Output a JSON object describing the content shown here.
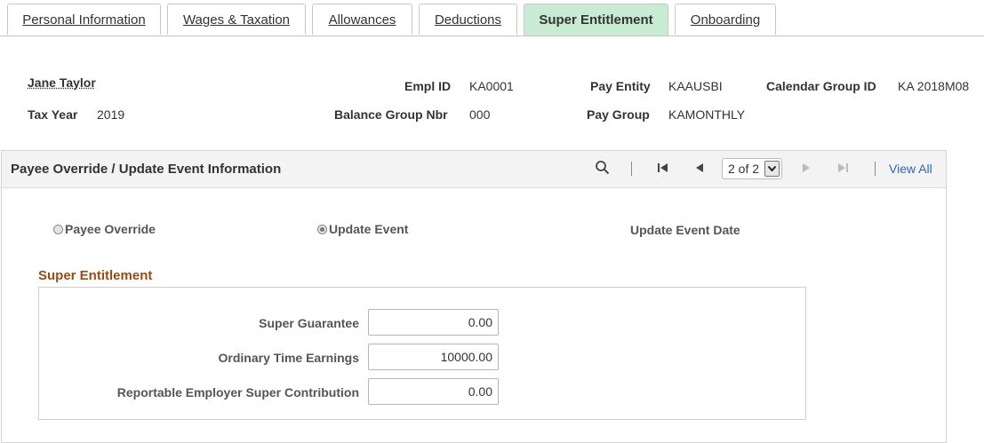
{
  "tabs": [
    {
      "label": "Personal Information",
      "active": false
    },
    {
      "label": "Wages & Taxation",
      "active": false
    },
    {
      "label": "Allowances",
      "active": false
    },
    {
      "label": "Deductions",
      "active": false
    },
    {
      "label": "Super Entitlement",
      "active": true
    },
    {
      "label": "Onboarding",
      "active": false
    }
  ],
  "header": {
    "employee_name": "Jane Taylor",
    "empl_id_label": "Empl ID",
    "empl_id_value": "KA0001",
    "pay_entity_label": "Pay Entity",
    "pay_entity_value": "KAAUSBI",
    "calendar_group_label": "Calendar Group ID",
    "calendar_group_value": "KA 2018M08",
    "tax_year_label": "Tax Year",
    "tax_year_value": "2019",
    "balance_group_label": "Balance Group Nbr",
    "balance_group_value": "000",
    "pay_group_label": "Pay Group",
    "pay_group_value": "KAMONTHLY"
  },
  "group": {
    "title": "Payee Override / Update Event Information",
    "pager_value": "2 of 2",
    "view_all": "View All"
  },
  "options": {
    "payee_override": "Payee Override",
    "update_event": "Update Event",
    "update_event_date": "Update Event Date",
    "selected": "update_event"
  },
  "super_entitlement": {
    "title": "Super Entitlement",
    "fields": [
      {
        "label": "Super Guarantee",
        "value": "0.00"
      },
      {
        "label": "Ordinary Time Earnings",
        "value": "10000.00"
      },
      {
        "label": "Reportable Employer Super Contribution",
        "value": "0.00"
      }
    ]
  },
  "colors": {
    "active_tab": "#c8ecd3",
    "section_title": "#9a4b12",
    "link": "#2d68b5"
  }
}
